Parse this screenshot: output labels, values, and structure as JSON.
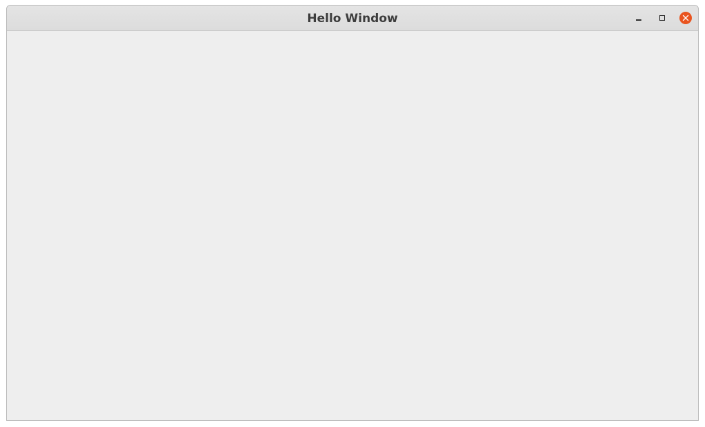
{
  "window": {
    "title": "Hello Window",
    "controls": {
      "minimize_icon": "minimize-icon",
      "maximize_icon": "maximize-icon",
      "close_icon": "close-icon"
    },
    "colors": {
      "titlebar": "#dfdfdf",
      "content_background": "#eeeeee",
      "close_button": "#e9541f",
      "title_text": "#3c3c3c"
    }
  }
}
